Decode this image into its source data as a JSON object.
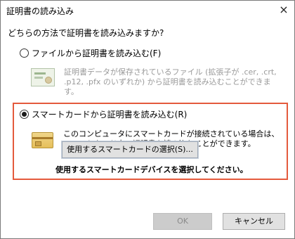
{
  "window": {
    "title": "証明書の読み込み",
    "close_glyph": "×"
  },
  "question": "どちらの方法で証明書を読み込みますか?",
  "options": {
    "file": {
      "label": "ファイルから証明書を読み込む(F)",
      "selected": false,
      "icon": "certificate-icon",
      "description": "証明書データが保存されているファイル (拡張子が .cer, .crt, .p12, .pfx のいずれか) から証明書を読み込むことができます。"
    },
    "smartcard": {
      "label": "スマートカードから証明書を読み込む(R)",
      "selected": true,
      "icon": "smart-card-icon",
      "description": "このコンピュータにスマートカードが接続されている場合は、スマートカード内の証明書を読み込むことができます。",
      "select_button": "使用するスマートカードの選択(S)...",
      "note": "使用するスマートカードデバイスを選択してください。"
    }
  },
  "buttons": {
    "ok": "OK",
    "cancel": "キャンセル"
  },
  "colors": {
    "highlight_border": "#e45a3c"
  }
}
